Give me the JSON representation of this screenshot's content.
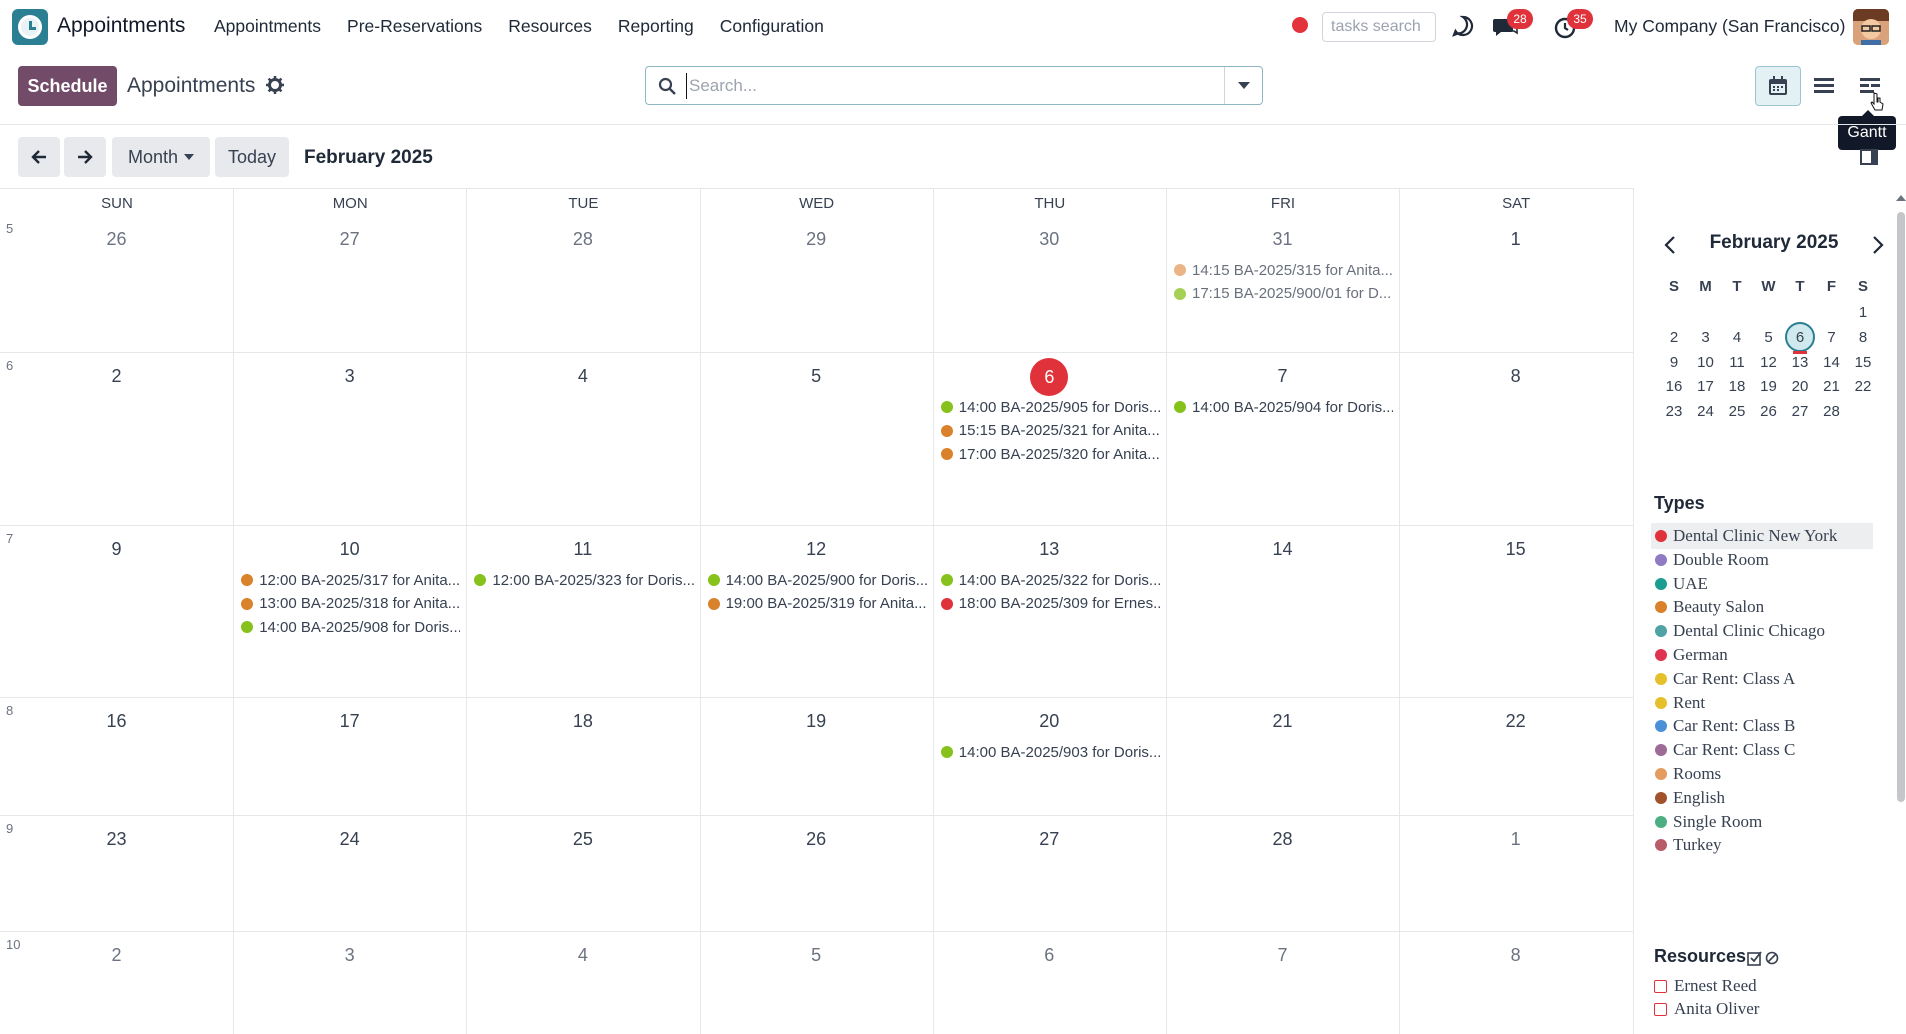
{
  "navbar": {
    "app_title": "Appointments",
    "menu": [
      "Appointments",
      "Pre-Reservations",
      "Resources",
      "Reporting",
      "Configuration"
    ],
    "tasks_search_placeholder": "tasks search",
    "chat_badge": "28",
    "activity_badge": "35",
    "company": "My Company (San Francisco)"
  },
  "control": {
    "schedule_label": "Schedule",
    "title": "Appointments",
    "search_placeholder": "Search...",
    "tooltip": "Gantt"
  },
  "calendar_toolbar": {
    "scale_label": "Month",
    "today_label": "Today",
    "period": "February 2025"
  },
  "calendar": {
    "days_of_week": [
      "SUN",
      "MON",
      "TUE",
      "WED",
      "THU",
      "FRI",
      "SAT"
    ],
    "weeks": [
      {
        "num": "5",
        "days": [
          "26",
          "27",
          "28",
          "29",
          "30",
          "31",
          "1"
        ]
      },
      {
        "num": "6",
        "days": [
          "2",
          "3",
          "4",
          "5",
          "6",
          "7",
          "8"
        ]
      },
      {
        "num": "7",
        "days": [
          "9",
          "10",
          "11",
          "12",
          "13",
          "14",
          "15"
        ]
      },
      {
        "num": "8",
        "days": [
          "16",
          "17",
          "18",
          "19",
          "20",
          "21",
          "22"
        ]
      },
      {
        "num": "9",
        "days": [
          "23",
          "24",
          "25",
          "26",
          "27",
          "28",
          "1"
        ]
      },
      {
        "num": "10",
        "days": [
          "2",
          "3",
          "4",
          "5",
          "6",
          "7",
          "8"
        ]
      }
    ],
    "events": [
      {
        "week": 0,
        "day": 5,
        "slot": 0,
        "text": "14:15 BA-2025/315 for Anita...",
        "color": "#e39b5f",
        "faded": true
      },
      {
        "week": 0,
        "day": 5,
        "slot": 1,
        "text": "17:15 BA-2025/900/01 for D...",
        "color": "#86c11c",
        "faded": true
      },
      {
        "week": 1,
        "day": 4,
        "slot": 0,
        "text": "14:00 BA-2025/905 for Doris...",
        "color": "#86c11c"
      },
      {
        "week": 1,
        "day": 4,
        "slot": 1,
        "text": "15:15 BA-2025/321 for Anita...",
        "color": "#d9822b"
      },
      {
        "week": 1,
        "day": 4,
        "slot": 2,
        "text": "17:00 BA-2025/320 for Anita...",
        "color": "#d9822b"
      },
      {
        "week": 1,
        "day": 5,
        "slot": 0,
        "text": "14:00 BA-2025/904 for Doris...",
        "color": "#86c11c"
      },
      {
        "week": 2,
        "day": 1,
        "slot": 0,
        "text": "12:00 BA-2025/317 for Anita...",
        "color": "#d9822b"
      },
      {
        "week": 2,
        "day": 1,
        "slot": 1,
        "text": "13:00 BA-2025/318 for Anita...",
        "color": "#d9822b"
      },
      {
        "week": 2,
        "day": 1,
        "slot": 2,
        "text": "14:00 BA-2025/908 for Doris...",
        "color": "#86c11c"
      },
      {
        "week": 2,
        "day": 2,
        "slot": 0,
        "text": "12:00 BA-2025/323 for Doris...",
        "color": "#86c11c"
      },
      {
        "week": 2,
        "day": 3,
        "slot": 0,
        "text": "14:00 BA-2025/900 for Doris...",
        "color": "#86c11c"
      },
      {
        "week": 2,
        "day": 3,
        "slot": 1,
        "text": "19:00 BA-2025/319 for Anita...",
        "color": "#d9822b"
      },
      {
        "week": 2,
        "day": 4,
        "slot": 0,
        "text": "14:00 BA-2025/322 for Doris...",
        "color": "#86c11c"
      },
      {
        "week": 2,
        "day": 4,
        "slot": 1,
        "text": "18:00 BA-2025/309 for Ernes...",
        "color": "#e0323b"
      },
      {
        "week": 3,
        "day": 4,
        "slot": 0,
        "text": "14:00 BA-2025/903 for Doris...",
        "color": "#86c11c"
      }
    ]
  },
  "mini_calendar": {
    "title": "February 2025",
    "dow": [
      "S",
      "M",
      "T",
      "W",
      "T",
      "F",
      "S"
    ],
    "rows": [
      [
        "",
        "",
        "",
        "",
        "",
        "",
        "1"
      ],
      [
        "2",
        "3",
        "4",
        "5",
        "6",
        "7",
        "8"
      ],
      [
        "9",
        "10",
        "11",
        "12",
        "13",
        "14",
        "15"
      ],
      [
        "16",
        "17",
        "18",
        "19",
        "20",
        "21",
        "22"
      ],
      [
        "23",
        "24",
        "25",
        "26",
        "27",
        "28",
        ""
      ]
    ],
    "today": "6"
  },
  "types": {
    "title": "Types",
    "items": [
      {
        "label": "Dental Clinic New York",
        "color": "#e0323b"
      },
      {
        "label": "Double Room",
        "color": "#8f7bc4"
      },
      {
        "label": "UAE",
        "color": "#1a9e8f"
      },
      {
        "label": "Beauty Salon",
        "color": "#d9822b"
      },
      {
        "label": "Dental Clinic Chicago",
        "color": "#4fa3a5"
      },
      {
        "label": "German",
        "color": "#e03352"
      },
      {
        "label": "Car Rent: Class A",
        "color": "#e6c02a"
      },
      {
        "label": "Rent",
        "color": "#e6c02a"
      },
      {
        "label": "Car Rent: Class B",
        "color": "#4a90d9"
      },
      {
        "label": "Car Rent: Class C",
        "color": "#9c6b96"
      },
      {
        "label": "Rooms",
        "color": "#e39b5f"
      },
      {
        "label": "English",
        "color": "#a0522d"
      },
      {
        "label": "Single Room",
        "color": "#4caf82"
      },
      {
        "label": "Turkey",
        "color": "#b85c68"
      }
    ]
  },
  "resources": {
    "title": "Resources",
    "items": [
      "Ernest Reed",
      "Anita Oliver"
    ]
  }
}
